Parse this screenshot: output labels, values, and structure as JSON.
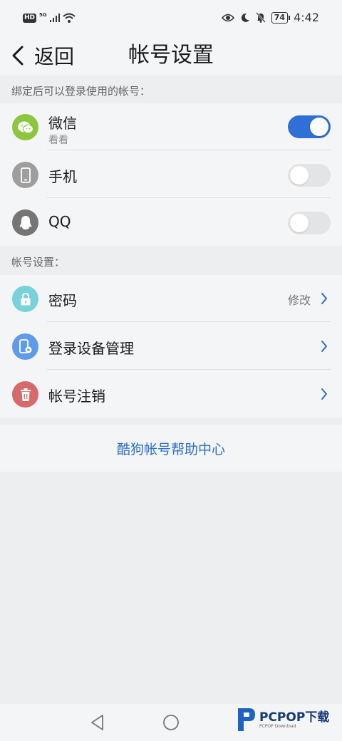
{
  "statusbar": {
    "hd_badge": "HD",
    "network": "5G",
    "battery": "74",
    "time": "4:42"
  },
  "header": {
    "back_label": "返回",
    "title": "帐号设置"
  },
  "bound_section": {
    "label": "绑定后可以登录使用的帐号：",
    "items": [
      {
        "title": "微信",
        "subtitle": "看看",
        "enabled": true,
        "icon": "wechat-icon",
        "color": "#8cc63f"
      },
      {
        "title": "手机",
        "enabled": false,
        "icon": "phone-icon",
        "color": "#9e9e9e"
      },
      {
        "title": "QQ",
        "enabled": false,
        "icon": "qq-icon",
        "color": "#757575"
      }
    ]
  },
  "account_section": {
    "label": "帐号设置：",
    "items": [
      {
        "title": "密码",
        "action": "修改",
        "icon": "lock-icon",
        "color": "#79d1d9"
      },
      {
        "title": "登录设备管理",
        "icon": "device-settings-icon",
        "color": "#5f9be8"
      },
      {
        "title": "帐号注销",
        "icon": "trash-icon",
        "color": "#d66a6a"
      }
    ]
  },
  "help_link": "酷狗帐号帮助中心",
  "watermark": {
    "main": "PCPOP下载",
    "sub": "PCPOP Download"
  },
  "colors": {
    "accent": "#2f6fd6",
    "link": "#2d6fc4"
  }
}
